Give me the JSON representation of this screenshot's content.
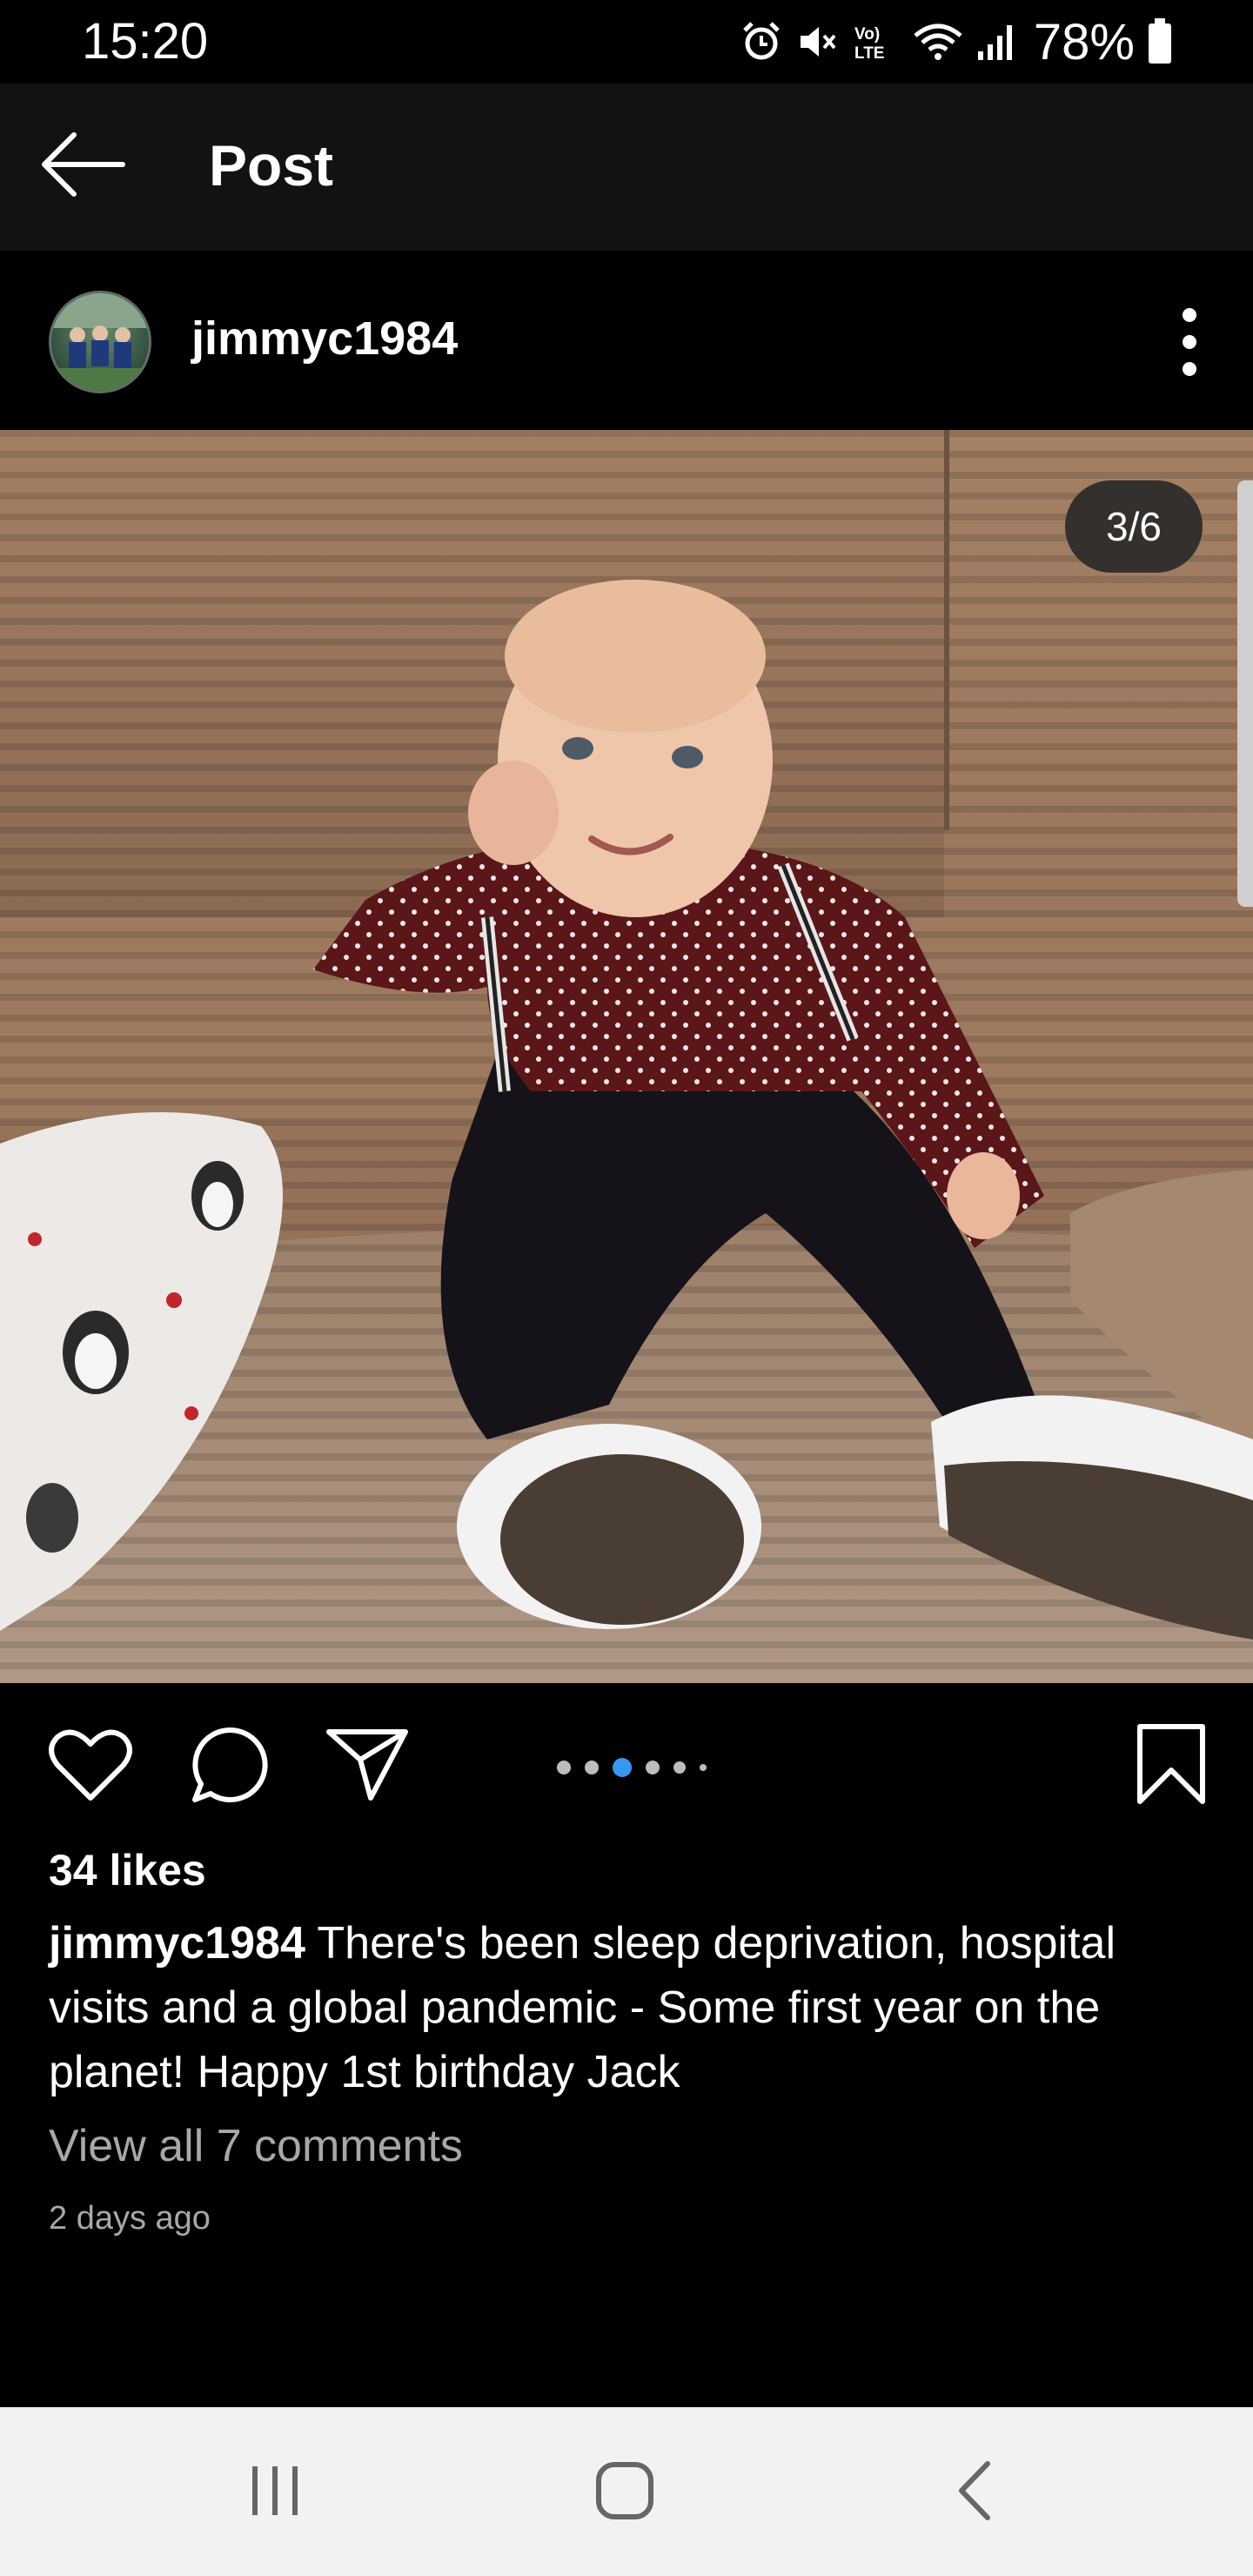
{
  "status_bar": {
    "time": "15:20",
    "battery_percent": "78%",
    "network_label": "Vo) LTE",
    "icons": [
      "alarm-icon",
      "mute-icon",
      "volte-icon",
      "wifi-icon",
      "signal-icon",
      "battery-icon"
    ]
  },
  "header": {
    "title": "Post",
    "back_icon": "arrow-left-icon"
  },
  "post": {
    "username": "jimmyc1984",
    "more_icon": "more-vertical-icon",
    "page_counter": "3/6",
    "carousel": {
      "total": 6,
      "active_index": 2
    },
    "likes": "34 likes",
    "caption_user": "jimmyc1984",
    "caption_text": "There's been sleep deprivation, hospital visits and a global pandemic - Some first year on the planet! Happy 1st birthday Jack",
    "view_comments": "View all 7 comments",
    "timestamp": "2 days ago"
  },
  "actions": {
    "like_icon": "heart-icon",
    "comment_icon": "comment-icon",
    "share_icon": "send-icon",
    "save_icon": "bookmark-icon"
  },
  "nav_bar": {
    "icons": [
      "recents-icon",
      "home-icon",
      "back-icon"
    ]
  },
  "colors": {
    "background": "#000000",
    "header_bg": "#121212",
    "accent_dot": "#3897f0",
    "muted_text": "#a8a8a8",
    "nav_bg": "#f2f2f2"
  }
}
